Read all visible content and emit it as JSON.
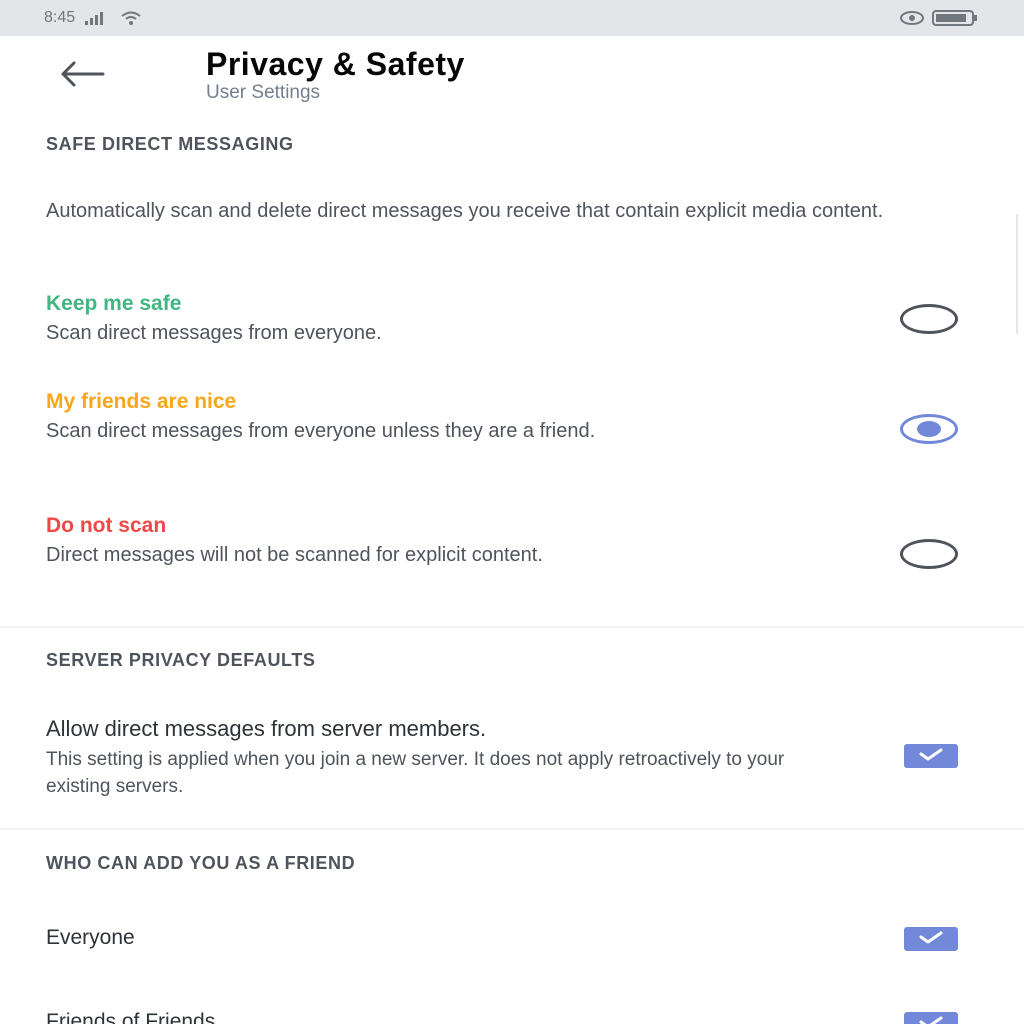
{
  "status_bar": {
    "time": "8:45"
  },
  "header": {
    "title": "Privacy & Safety",
    "subtitle": "User Settings"
  },
  "safe_dm": {
    "heading": "SAFE DIRECT MESSAGING",
    "description": "Automatically scan and delete direct messages you receive that contain explicit media content.",
    "options": [
      {
        "title": "Keep me safe",
        "subtitle": "Scan direct messages from everyone.",
        "color": "#43b581",
        "selected": false
      },
      {
        "title": "My friends are nice",
        "subtitle": "Scan direct messages from everyone unless they are a friend.",
        "color": "#faa61a",
        "selected": true
      },
      {
        "title": "Do not scan",
        "subtitle": "Direct messages will not be scanned for explicit content.",
        "color": "#f04747",
        "selected": false
      }
    ]
  },
  "server_privacy": {
    "heading": "SERVER PRIVACY DEFAULTS",
    "setting_title": "Allow direct messages from server members.",
    "setting_sub": "This setting is applied when you join a new server. It does not apply retroactively to your existing servers.",
    "checked": true
  },
  "friend_requests": {
    "heading": "WHO CAN ADD YOU AS A FRIEND",
    "everyone_label": "Everyone",
    "everyone_checked": true,
    "friends_of_friends_label": "Friends of Friends",
    "friends_of_friends_checked": true
  },
  "colors": {
    "accent": "#7289da",
    "safe": "#43b581",
    "warning": "#faa61a",
    "danger": "#f04747"
  },
  "icons": {
    "back": "arrow-left-icon",
    "checkbox": "checkmark-icon",
    "signal": "signal-icon",
    "wifi": "wifi-icon",
    "battery": "battery-icon",
    "eye": "eye-icon"
  }
}
